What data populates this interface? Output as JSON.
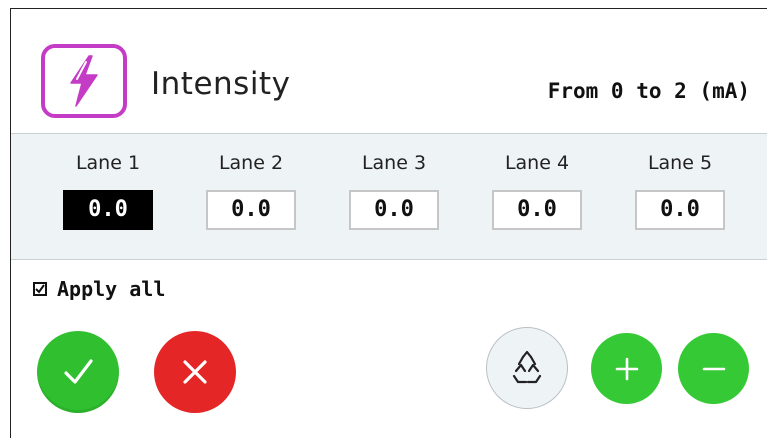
{
  "header": {
    "icon": "lightning-icon",
    "title": "Intensity",
    "range_text": "From 0 to 2 (mA)",
    "accent_color": "#c43cc6"
  },
  "lanes": [
    {
      "label": "Lane 1",
      "value": "0.0",
      "selected": true
    },
    {
      "label": "Lane 2",
      "value": "0.0",
      "selected": false
    },
    {
      "label": "Lane 3",
      "value": "0.0",
      "selected": false
    },
    {
      "label": "Lane 4",
      "value": "0.0",
      "selected": false
    },
    {
      "label": "Lane 5",
      "value": "0.0",
      "selected": false
    }
  ],
  "apply_all": {
    "label": "Apply all",
    "checked": true
  },
  "actions": {
    "confirm_icon": "checkmark-icon",
    "cancel_icon": "close-icon",
    "reset_icon": "recycle-icon",
    "increment_icon": "plus-icon",
    "decrement_icon": "minus-icon",
    "confirm_color": "#2fbf2f",
    "cancel_color": "#e52626",
    "stepper_color": "#35c935",
    "reset_color": "#eef3f5"
  }
}
